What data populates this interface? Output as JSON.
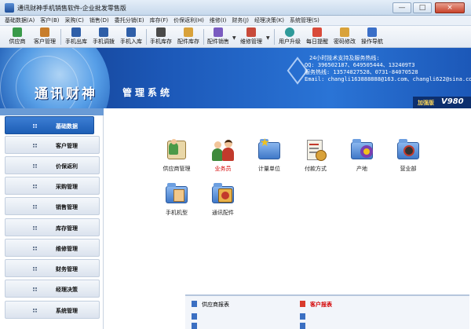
{
  "window": {
    "title": "通讯财神手机销售软件-企业批发零售版",
    "minimize": "—",
    "maximize": "□",
    "close": "×"
  },
  "menu": [
    "基础数据(A)",
    "客户(B)",
    "采购(C)",
    "销售(D)",
    "库存(F)",
    "价保返利(H)",
    "维修(I)",
    "财务(J)",
    "经理决策(K)",
    "系统管理(S)"
  ],
  "menu_extra": [
    "委托分销(E)"
  ],
  "toolbar": {
    "supplier": "供应商",
    "customer_mgmt": "客户管理",
    "phone_out": "手机出库",
    "phone_transfer": "手机调拨",
    "phone_in": "手机入库",
    "phone_stock": "手机库存",
    "parts_stock": "配件库存",
    "parts_sales": "配件销售",
    "repair_mgmt": "维修管理",
    "user_upgrade": "用户升级",
    "daily_reminder": "每日提醒",
    "change_password": "密码修改",
    "guide": "操作导航"
  },
  "banner": {
    "brand": "通讯财神",
    "subtitle": "管理系统",
    "hotline_title": "24小时技术支持及服务热线:",
    "qq": "QQ: 396502187、649505444、132409T3",
    "phone": "服务热线: 13574827528、0731-84070528",
    "email": "Email: changli163888888@163.com、changli622@sina.com",
    "edition": "加强版",
    "version": "V980"
  },
  "sidebar": {
    "items": [
      "基础数据",
      "客户管理",
      "价保返利",
      "采购管理",
      "销售管理",
      "库存管理",
      "维修管理",
      "财务管理",
      "经理决策",
      "系统管理"
    ],
    "active_index": 0
  },
  "modules": [
    {
      "label": "供应商管理",
      "icon": "supplier-mgmt-icon",
      "highlight": false
    },
    {
      "label": "业务员",
      "icon": "salesperson-icon",
      "highlight": true
    },
    {
      "label": "计量单位",
      "icon": "unit-icon",
      "highlight": false
    },
    {
      "label": "付款方式",
      "icon": "payment-method-icon",
      "highlight": false
    },
    {
      "label": "产地",
      "icon": "origin-icon",
      "highlight": false
    },
    {
      "label": "营业部",
      "icon": "branch-icon",
      "highlight": false
    },
    {
      "label": "手机机型",
      "icon": "phone-model-icon",
      "highlight": false
    },
    {
      "label": "通讯配件",
      "icon": "accessory-icon",
      "highlight": false
    }
  ],
  "reports": {
    "left_title": "供应商报表",
    "right_title": "客户报表"
  },
  "colors": {
    "accent": "#1d5eb5",
    "highlight_text": "#d40000"
  }
}
